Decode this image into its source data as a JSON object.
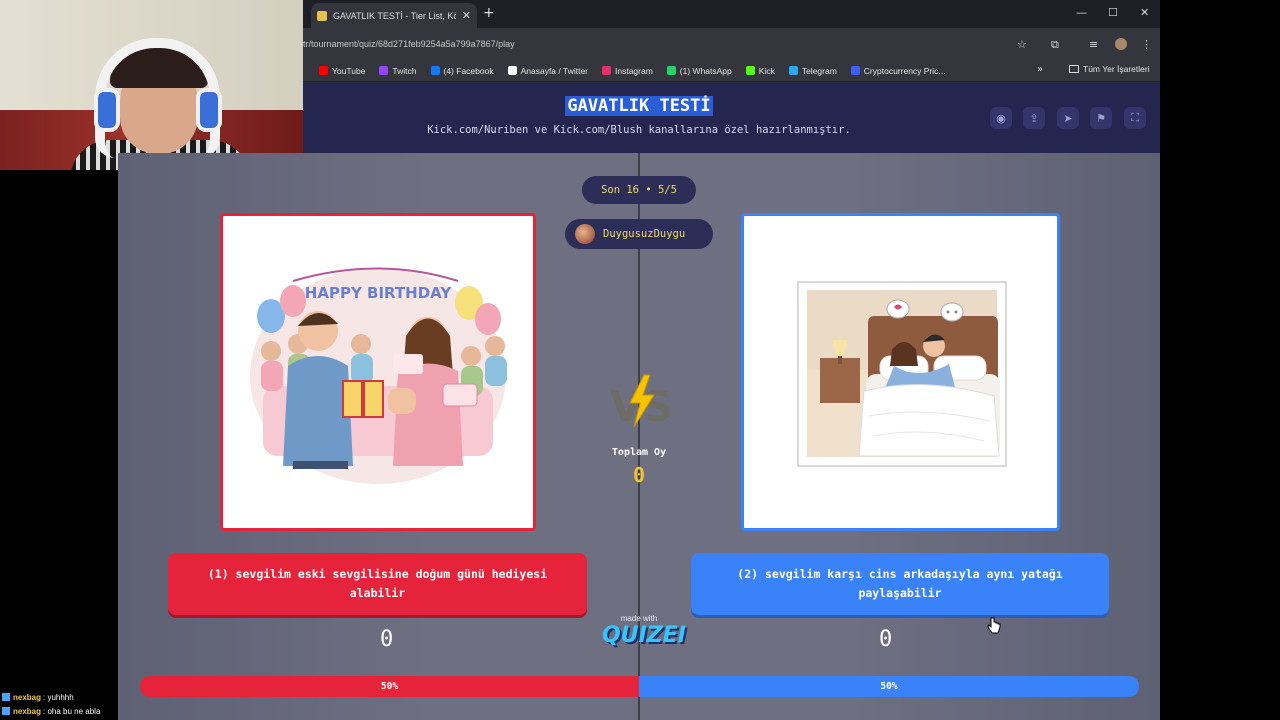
{
  "browser": {
    "tab_title": "GAVATLIK TESTİ - Tier List, Kör",
    "url": "tr/tournament/quiz/68d271feb9254a5a799a7867/play",
    "bookmarks": [
      {
        "label": "YouTube",
        "color": "#ff0000"
      },
      {
        "label": "Twitch",
        "color": "#9146ff"
      },
      {
        "label": "(4) Facebook",
        "color": "#1877f2"
      },
      {
        "label": "Anasayfa / Twitter",
        "color": "#ffffff"
      },
      {
        "label": "Instagram",
        "color": "#e1306c"
      },
      {
        "label": "(1) WhatsApp",
        "color": "#25d366"
      },
      {
        "label": "Kick",
        "color": "#53fc18"
      },
      {
        "label": "Telegram",
        "color": "#2aabee"
      },
      {
        "label": "Cryptocurrency Pric...",
        "color": "#3861fb"
      }
    ],
    "all_bookmarks": "Tüm Yer İşaretleri"
  },
  "site": {
    "title": "GAVATLIK TESTİ",
    "subtitle": "Kick.com/Nuriben ve Kick.com/Blush kanallarına özel hazırlanmıştır."
  },
  "game": {
    "round": "Son 16 • 5/5",
    "username": "DuygusuzDuygu",
    "total_label": "Toplam Oy",
    "total_value": "0",
    "left": {
      "choice": "(1) sevgilim eski sevgilisine doğum günü hediyesi alabilir",
      "votes": "0",
      "percent": "50%",
      "banner_text": "HAPPY BIRTHDAY",
      "color": "#e5243b"
    },
    "right": {
      "choice": "(2) sevgilim karşı cins arkadaşıyla aynı yatağı paylaşabilir",
      "votes": "0",
      "percent": "50%",
      "color": "#3a82f7"
    },
    "made_with": "made with",
    "brand": "QUIZEI",
    "vote_split": {
      "left": 0.5,
      "right": 0.5
    }
  },
  "chat": [
    {
      "user": "nexbag",
      "text": ": yuhhhh"
    },
    {
      "user": "nexbag",
      "text": ": oha bu ne abla"
    }
  ]
}
